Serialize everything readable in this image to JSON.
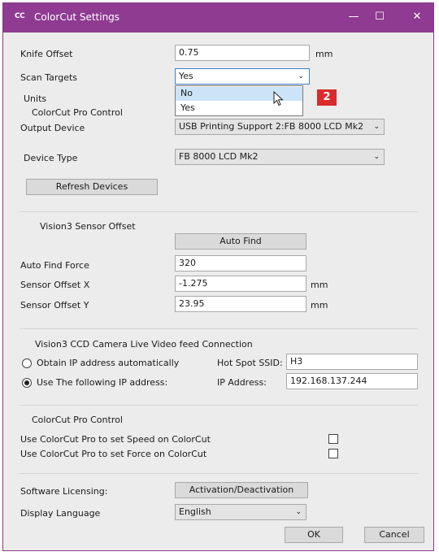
{
  "window": {
    "logo": "CC",
    "title": "ColorCut Settings",
    "minimize": "—",
    "maximize": "☐",
    "close": "✕"
  },
  "settings": {
    "knife_offset_label": "Knife Offset",
    "knife_offset_value": "0.75",
    "knife_offset_unit": "mm",
    "scan_targets_label": "Scan Targets",
    "scan_targets_value": "Yes",
    "scan_targets_options": [
      "No",
      "Yes"
    ],
    "units_label": "Units",
    "colorcut_pro_control_sub": "ColorCut Pro Control",
    "output_device_label": "Output Device",
    "output_device_value": "USB Printing Support 2:FB 8000 LCD Mk2",
    "device_type_label": "Device Type",
    "device_type_value": "FB 8000 LCD Mk2",
    "refresh_devices": "Refresh Devices"
  },
  "sensor": {
    "heading": "Vision3 Sensor Offset",
    "auto_find": "Auto Find",
    "auto_find_force_label": "Auto Find Force",
    "auto_find_force_value": "320",
    "offset_x_label": "Sensor Offset X",
    "offset_x_value": "-1.275",
    "offset_x_unit": "mm",
    "offset_y_label": "Sensor Offset Y",
    "offset_y_value": "23.95",
    "offset_y_unit": "mm"
  },
  "camera": {
    "heading": "Vision3 CCD Camera Live Video feed Connection",
    "obtain_ip_label": "Obtain IP address automatically",
    "use_ip_label": "Use The following IP address:",
    "selected": "use_ip",
    "ssid_label": "Hot Spot SSID:",
    "ssid_value": "H3",
    "ip_label": "IP Address:",
    "ip_value": "192.168.137.244"
  },
  "pro_control": {
    "heading": "ColorCut Pro Control",
    "speed_label": "Use ColorCut Pro to set Speed on ColorCut",
    "speed_checked": false,
    "force_label": "Use ColorCut Pro to set Force on ColorCut",
    "force_checked": false
  },
  "licensing": {
    "label": "Software Licensing:",
    "button": "Activation/Deactivation",
    "language_label": "Display Language",
    "language_value": "English"
  },
  "footer": {
    "ok": "OK",
    "cancel": "Cancel"
  },
  "annotation": {
    "badge": "2"
  },
  "colors": {
    "titlebar": "#8e3b91",
    "badge": "#d92b2b"
  }
}
